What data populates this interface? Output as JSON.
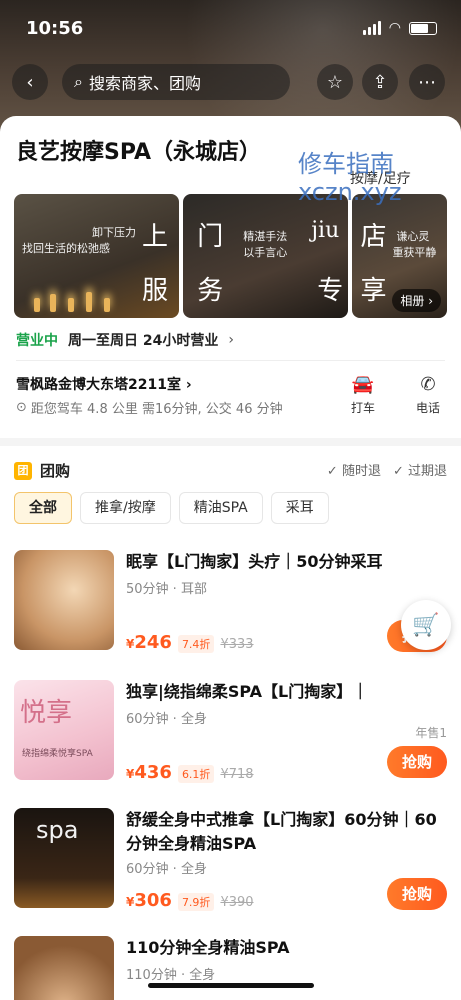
{
  "status": {
    "time": "10:56"
  },
  "nav": {
    "search_placeholder": "搜索商家、团购"
  },
  "shop": {
    "name": "良艺按摩SPA（永城店）",
    "category_tag": "按摩/足疗",
    "watermark_line1": "修车指南",
    "watermark_line2": "xczn.xyz",
    "gallery": {
      "img1_big": [
        "上",
        "服"
      ],
      "img1_text": [
        "卸下压力",
        "找回生活的松弛感"
      ],
      "img2_big": [
        "门",
        "务",
        "jiu",
        "专"
      ],
      "img2_text": [
        "精湛手法",
        "以手言心"
      ],
      "img3_big": [
        "店",
        "享"
      ],
      "img3_text": [
        "谦心灵",
        "重获平静"
      ],
      "album_label": "相册"
    },
    "open_status": "营业中",
    "hours": "周一至周日 24小时营业",
    "address": "雪枫路金博大东塔2211室",
    "distance": "距您驾车 4.8 公里 需16分钟, 公交 46 分钟",
    "actions": {
      "taxi": "打车",
      "phone": "电话"
    }
  },
  "group": {
    "badge": "团",
    "title": "团购",
    "policy_anytime": "随时退",
    "policy_expired": "过期退",
    "tabs": [
      "全部",
      "推拿/按摩",
      "精油SPA",
      "采耳"
    ],
    "deals": [
      {
        "title": "眠享【L门掏家】头疗｜50分钟采耳",
        "meta": "50分钟 · 耳部",
        "price": "246",
        "discount": "7.4折",
        "orig": "¥333",
        "buy": "抢购",
        "img_text": ""
      },
      {
        "title": "独享|绕指绵柔SPA【L门掏家】｜",
        "meta": "60分钟 · 全身",
        "price": "436",
        "discount": "6.1折",
        "orig": "¥718",
        "buy": "抢购",
        "sold": "年售1",
        "img_text": "悦享",
        "img_sub": "绕指绵柔悦享SPA"
      },
      {
        "title": "舒缓全身中式推拿【L门掏家】60分钟｜60分钟全身精油SPA",
        "meta": "60分钟 · 全身",
        "price": "306",
        "discount": "7.9折",
        "orig": "¥390",
        "buy": "抢购",
        "img_text": "spa"
      },
      {
        "title": "110分钟全身精油SPA",
        "meta": "110分钟 · 全身"
      }
    ],
    "currency": "¥"
  },
  "colors": {
    "accent": "#ff5a1f",
    "open": "#1aa34a",
    "badge": "#ffb400"
  }
}
